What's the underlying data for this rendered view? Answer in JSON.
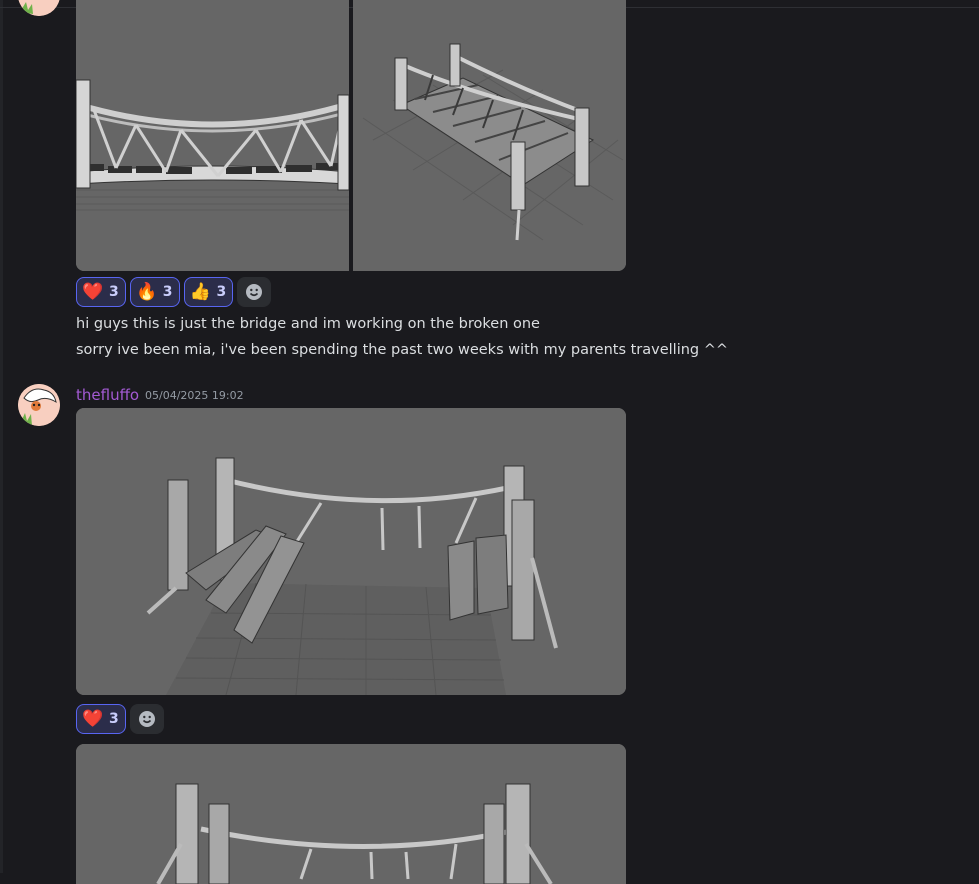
{
  "messages": [
    {
      "reactions": [
        {
          "emoji_name": "red-heart",
          "emoji": "❤️",
          "count": "3"
        },
        {
          "emoji_name": "fire",
          "emoji": "🔥",
          "count": "3"
        },
        {
          "emoji_name": "thumbs-up",
          "emoji": "👍",
          "count": "3"
        }
      ],
      "lines": [
        "hi guys this is just the bridge and im working on the broken one",
        "sorry ive been mia, i've been spending the past two weeks with my parents travelling ^^"
      ]
    },
    {
      "author": "thefluffo",
      "timestamp": "05/04/2025 19:02",
      "reactions": [
        {
          "emoji_name": "red-heart",
          "emoji": "❤️",
          "count": "3"
        }
      ]
    }
  ],
  "icons": {
    "add_reaction": "smiley-face-icon",
    "corner_button": "app-grid-icon"
  },
  "colors": {
    "background": "#1a1a1e",
    "username": "#a35ad3",
    "reaction_border": "#5865f2",
    "viewport": "#646464"
  }
}
